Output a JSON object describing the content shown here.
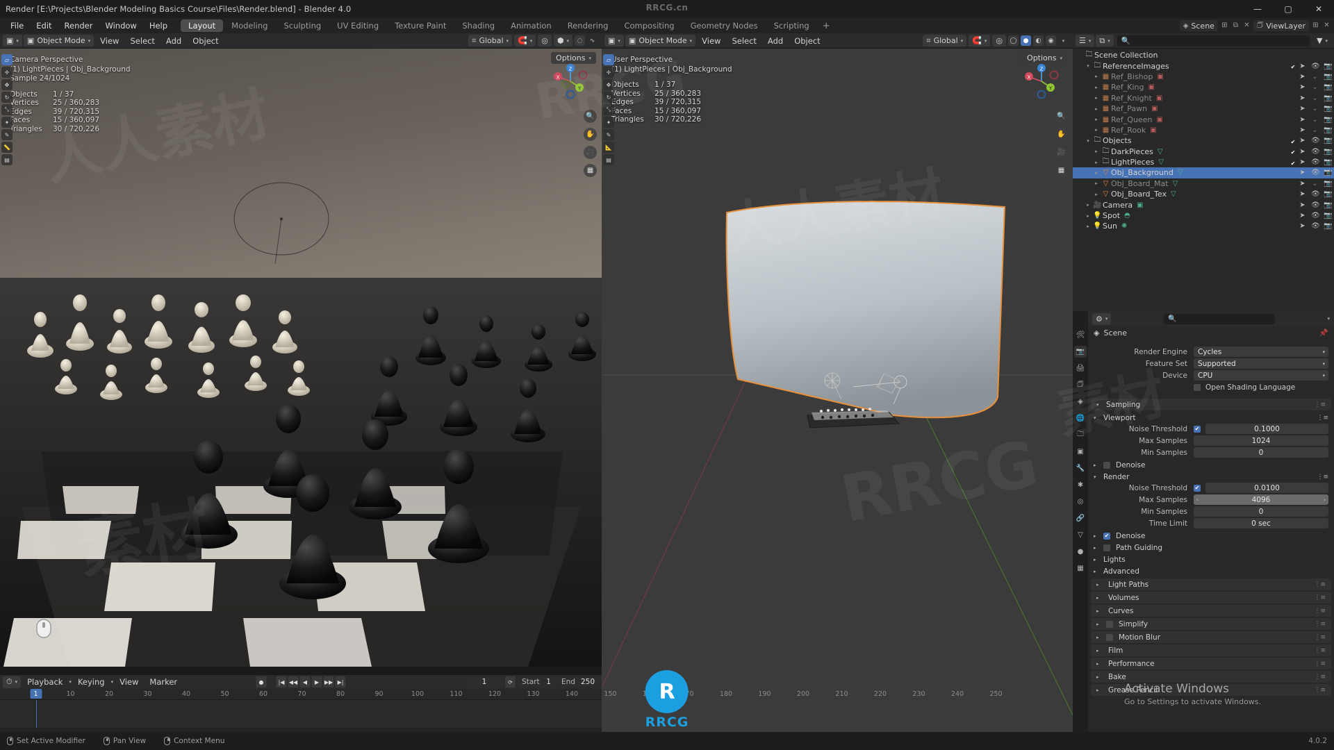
{
  "window": {
    "title": "Render [E:\\Projects\\Blender Modeling Basics Course\\Files\\Render.blend] - Blender 4.0",
    "minimize": "—",
    "maximize": "▢",
    "close": "✕",
    "watermark_top": "RRCG.cn",
    "version": "4.0.2"
  },
  "menu": {
    "items": [
      "File",
      "Edit",
      "Render",
      "Window",
      "Help"
    ]
  },
  "workspaces": {
    "tabs": [
      "Layout",
      "Modeling",
      "Sculpting",
      "UV Editing",
      "Texture Paint",
      "Shading",
      "Animation",
      "Rendering",
      "Compositing",
      "Geometry Nodes",
      "Scripting"
    ],
    "active": "Layout",
    "add": "+"
  },
  "topbar_right": {
    "scene_icon": "scene-icon",
    "scene_name": "Scene",
    "viewlayer_icon": "viewlayer-icon",
    "viewlayer_name": "ViewLayer",
    "new_btn": "new-scene-icon",
    "delete_btn": "delete-scene-icon"
  },
  "viewport_left": {
    "mode": "Object Mode",
    "menus": [
      "View",
      "Select",
      "Add",
      "Object"
    ],
    "transform_orientation": "Global",
    "options_label": "Options",
    "overlay": {
      "perspective": "Camera Perspective",
      "active": "(1) LightPieces | Obj_Background",
      "sample": "Sample 24/1024",
      "stats": [
        {
          "label": "Objects",
          "value": "1 / 37"
        },
        {
          "label": "Vertices",
          "value": "25 / 360,283"
        },
        {
          "label": "Edges",
          "value": "39 / 720,315"
        },
        {
          "label": "Faces",
          "value": "15 / 360,097"
        },
        {
          "label": "Triangles",
          "value": "30 / 720,226"
        }
      ]
    }
  },
  "viewport_right": {
    "mode": "Object Mode",
    "menus": [
      "View",
      "Select",
      "Add",
      "Object"
    ],
    "transform_orientation": "Global",
    "options_label": "Options",
    "overlay": {
      "perspective": "User Perspective",
      "active": "(1) LightPieces | Obj_Background",
      "stats": [
        {
          "label": "Objects",
          "value": "1 / 37"
        },
        {
          "label": "Vertices",
          "value": "25 / 360,283"
        },
        {
          "label": "Edges",
          "value": "39 / 720,315"
        },
        {
          "label": "Faces",
          "value": "15 / 360,097"
        },
        {
          "label": "Triangles",
          "value": "30 / 720,226"
        }
      ]
    },
    "gizmo_axes": [
      "X",
      "Y",
      "Z"
    ]
  },
  "tools": {
    "icons": [
      "tweak-select-icon",
      "cursor-icon",
      "move-icon",
      "rotate-icon",
      "scale-icon",
      "transform-icon",
      "annotate-icon",
      "measure-icon",
      "add-cube-icon"
    ]
  },
  "nav_buttons": [
    "zoom-icon",
    "pan-hand-icon",
    "camera-view-icon",
    "grid-ortho-icon"
  ],
  "timeline": {
    "menus": [
      "Playback",
      "Keying",
      "View",
      "Marker"
    ],
    "record_icon": "record-keyframe-icon",
    "transport": [
      "jump-start-icon",
      "prev-keyframe-icon",
      "play-reverse-icon",
      "play-icon",
      "next-keyframe-icon",
      "jump-end-icon"
    ],
    "current_frame": "1",
    "sync_icon": "sync-icon",
    "start_label": "Start",
    "start_value": "1",
    "end_label": "End",
    "end_value": "250",
    "ticks": [
      "10",
      "20",
      "30",
      "40",
      "50",
      "60",
      "70",
      "80",
      "90",
      "100",
      "110",
      "120",
      "130",
      "140",
      "150",
      "160",
      "170",
      "180",
      "190",
      "200",
      "210",
      "220",
      "230",
      "240",
      "250"
    ],
    "playhead_frame": "1"
  },
  "outliner": {
    "display_mode_icon": "view-layer-icon",
    "filter_icon": "filter-icon",
    "search_placeholder": "",
    "search_icon": "search-icon",
    "root": "Scene Collection",
    "items": [
      {
        "name": "Scene Collection",
        "depth": 0,
        "icon": "collection-icon",
        "expand": "",
        "selected": false,
        "dim": false,
        "checkbox": null,
        "cursor": false,
        "eye": false,
        "camera": false,
        "data_icon": ""
      },
      {
        "name": "ReferenceImages",
        "depth": 1,
        "icon": "collection-icon",
        "expand": "▾",
        "selected": false,
        "dim": false,
        "checkbox": "on",
        "cursor": true,
        "eye": true,
        "camera": true,
        "data_icon": ""
      },
      {
        "name": "Ref_Bishop",
        "depth": 2,
        "icon": "image-empty-icon",
        "expand": "▸",
        "selected": false,
        "dim": true,
        "checkbox": null,
        "cursor": true,
        "eye": false,
        "camera": true,
        "data_icon": "image-data-icon"
      },
      {
        "name": "Ref_King",
        "depth": 2,
        "icon": "image-empty-icon",
        "expand": "▸",
        "selected": false,
        "dim": true,
        "checkbox": null,
        "cursor": true,
        "eye": false,
        "camera": true,
        "data_icon": "image-data-icon"
      },
      {
        "name": "Ref_Knight",
        "depth": 2,
        "icon": "image-empty-icon",
        "expand": "▸",
        "selected": false,
        "dim": true,
        "checkbox": null,
        "cursor": true,
        "eye": false,
        "camera": true,
        "data_icon": "image-data-icon"
      },
      {
        "name": "Ref_Pawn",
        "depth": 2,
        "icon": "image-empty-icon",
        "expand": "▸",
        "selected": false,
        "dim": true,
        "checkbox": null,
        "cursor": true,
        "eye": false,
        "camera": true,
        "data_icon": "image-data-icon"
      },
      {
        "name": "Ref_Queen",
        "depth": 2,
        "icon": "image-empty-icon",
        "expand": "▸",
        "selected": false,
        "dim": true,
        "checkbox": null,
        "cursor": true,
        "eye": false,
        "camera": true,
        "data_icon": "image-data-icon"
      },
      {
        "name": "Ref_Rook",
        "depth": 2,
        "icon": "image-empty-icon",
        "expand": "▸",
        "selected": false,
        "dim": true,
        "checkbox": null,
        "cursor": true,
        "eye": false,
        "camera": true,
        "data_icon": "image-data-icon"
      },
      {
        "name": "Objects",
        "depth": 1,
        "icon": "collection-icon",
        "expand": "▾",
        "selected": false,
        "dim": false,
        "checkbox": "on",
        "cursor": true,
        "eye": true,
        "camera": true,
        "data_icon": ""
      },
      {
        "name": "DarkPieces",
        "depth": 2,
        "icon": "collection-icon",
        "expand": "▸",
        "selected": false,
        "dim": false,
        "checkbox": "on",
        "cursor": true,
        "eye": true,
        "camera": true,
        "data_icon": "multi-object-icon"
      },
      {
        "name": "LightPieces",
        "depth": 2,
        "icon": "collection-icon",
        "expand": "▸",
        "selected": false,
        "dim": false,
        "checkbox": "on",
        "cursor": true,
        "eye": true,
        "camera": true,
        "data_icon": "multi-object-icon"
      },
      {
        "name": "Obj_Background",
        "depth": 2,
        "icon": "mesh-object-icon",
        "expand": "▸",
        "selected": true,
        "dim": false,
        "checkbox": null,
        "cursor": true,
        "eye": true,
        "camera": true,
        "data_icon": "mesh-data-icon"
      },
      {
        "name": "Obj_Board_Mat",
        "depth": 2,
        "icon": "mesh-object-icon",
        "expand": "▸",
        "selected": false,
        "dim": true,
        "checkbox": null,
        "cursor": true,
        "eye": false,
        "camera": true,
        "data_icon": "mesh-data-icon"
      },
      {
        "name": "Obj_Board_Tex",
        "depth": 2,
        "icon": "mesh-object-icon",
        "expand": "▸",
        "selected": false,
        "dim": false,
        "checkbox": null,
        "cursor": true,
        "eye": true,
        "camera": true,
        "data_icon": "mesh-data-icon"
      },
      {
        "name": "Camera",
        "depth": 1,
        "icon": "camera-object-icon",
        "expand": "▸",
        "selected": false,
        "dim": false,
        "checkbox": null,
        "cursor": true,
        "eye": true,
        "camera": true,
        "data_icon": "camera-data-icon"
      },
      {
        "name": "Spot",
        "depth": 1,
        "icon": "light-object-icon",
        "expand": "▸",
        "selected": false,
        "dim": false,
        "checkbox": null,
        "cursor": true,
        "eye": true,
        "camera": true,
        "data_icon": "spot-light-icon"
      },
      {
        "name": "Sun",
        "depth": 1,
        "icon": "light-object-icon",
        "expand": "▸",
        "selected": false,
        "dim": false,
        "checkbox": null,
        "cursor": true,
        "eye": true,
        "camera": true,
        "data_icon": "sun-light-icon"
      }
    ]
  },
  "properties": {
    "tabs": [
      "tool-icon",
      "render-icon",
      "output-icon",
      "viewlayer-icon",
      "scene-icon",
      "world-icon",
      "collection-icon",
      "object-icon",
      "modifier-icon",
      "particles-icon",
      "physics-icon",
      "constraint-icon",
      "data-icon",
      "material-icon",
      "texture-icon"
    ],
    "active_tab_index": 1,
    "search_placeholder": "",
    "breadcrumb": "Scene",
    "breadcrumb_icon": "scene-icon",
    "pin_icon": "pin-icon",
    "fields": [
      {
        "label": "Render Engine",
        "value": "Cycles",
        "type": "dropdown"
      },
      {
        "label": "Feature Set",
        "value": "Supported",
        "type": "dropdown"
      },
      {
        "label": "Device",
        "value": "CPU",
        "type": "dropdown"
      }
    ],
    "osl": {
      "label": "Open Shading Language",
      "checked": false
    },
    "sampling": {
      "title": "Sampling",
      "viewport": {
        "title": "Viewport",
        "noise_threshold": {
          "label": "Noise Threshold",
          "value": "0.1000",
          "checked": true
        },
        "max_samples": {
          "label": "Max Samples",
          "value": "1024"
        },
        "min_samples": {
          "label": "Min Samples",
          "value": "0"
        },
        "denoise": {
          "label": "Denoise",
          "checked": false
        }
      },
      "render": {
        "title": "Render",
        "noise_threshold": {
          "label": "Noise Threshold",
          "value": "0.0100",
          "checked": true
        },
        "max_samples": {
          "label": "Max Samples",
          "value": "4096"
        },
        "min_samples": {
          "label": "Min Samples",
          "value": "0"
        },
        "time_limit": {
          "label": "Time Limit",
          "value": "0 sec"
        },
        "denoise": {
          "label": "Denoise",
          "checked": true
        },
        "path_guiding": {
          "label": "Path Guiding",
          "checked": false
        },
        "lights": {
          "label": "Lights"
        },
        "advanced": {
          "label": "Advanced"
        }
      }
    },
    "panels": [
      {
        "label": "Light Paths",
        "checkbox": null
      },
      {
        "label": "Volumes",
        "checkbox": null
      },
      {
        "label": "Curves",
        "checkbox": null
      },
      {
        "label": "Simplify",
        "checkbox": "off"
      },
      {
        "label": "Motion Blur",
        "checkbox": "off"
      },
      {
        "label": "Film",
        "checkbox": null
      },
      {
        "label": "Performance",
        "checkbox": null
      },
      {
        "label": "Bake",
        "checkbox": null
      },
      {
        "label": "Grease Pencil",
        "checkbox": null
      }
    ]
  },
  "statusbar": {
    "items": [
      {
        "icon": "mouse-left-icon",
        "label": "Set Active Modifier"
      },
      {
        "icon": "mouse-middle-icon",
        "label": "Pan View"
      },
      {
        "icon": "mouse-right-icon",
        "label": "Context Menu"
      }
    ],
    "version": "4.0.2"
  },
  "activate_windows": {
    "title": "Activate Windows",
    "subtitle": "Go to Settings to activate Windows."
  },
  "branding": {
    "logo_letter": "R",
    "name": "RRCG",
    "sub": "人人素材",
    "watermarks": [
      "RRCG",
      "人人素材",
      "素材",
      "RRCG"
    ]
  }
}
